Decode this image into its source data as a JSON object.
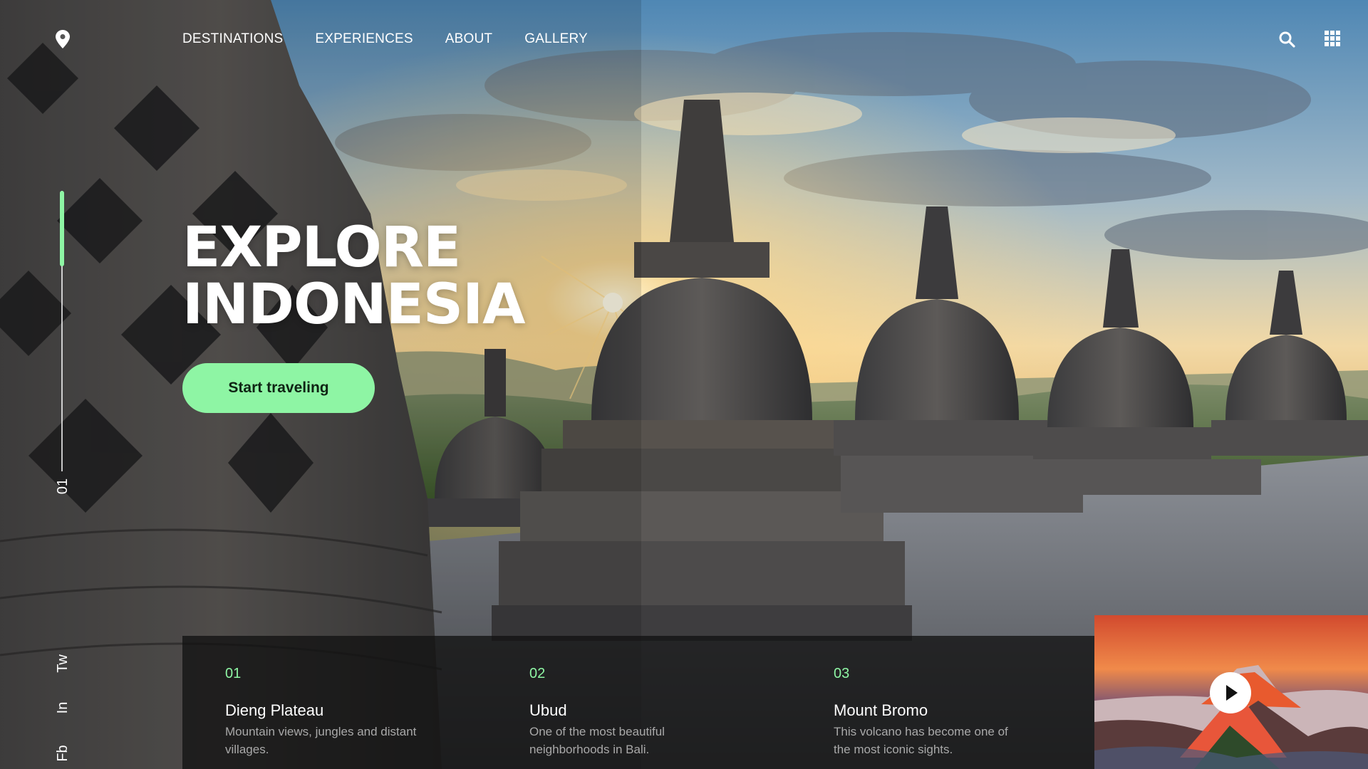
{
  "nav": {
    "logo_icon": "map-pin-icon",
    "menu": [
      "DESTINATIONS",
      "EXPERIENCES",
      "ABOUT",
      "GALLERY"
    ],
    "search_icon": "search-icon",
    "grid_icon": "grid-menu-icon"
  },
  "hero": {
    "title_line1": "EXPLORE",
    "title_line2": "INDONESIA",
    "cta_label": "Start traveling",
    "slide_number": "01",
    "slide_progress_fraction": 0.27
  },
  "social": [
    "Tw",
    "In",
    "Fb"
  ],
  "destinations": [
    {
      "number": "01",
      "title": "Dieng Plateau",
      "description": "Mountain views, jungles and distant villages."
    },
    {
      "number": "02",
      "title": "Ubud",
      "description": "One of the most beautiful neighborhoods in Bali."
    },
    {
      "number": "03",
      "title": "Mount Bromo",
      "description": "This volcano has become one of the most iconic sights."
    }
  ],
  "video": {
    "play_icon": "play-icon"
  },
  "colors": {
    "accent": "#8ef5a4",
    "card_bg": "#121212",
    "text": "#ffffff",
    "muted": "#a9a9a9"
  }
}
